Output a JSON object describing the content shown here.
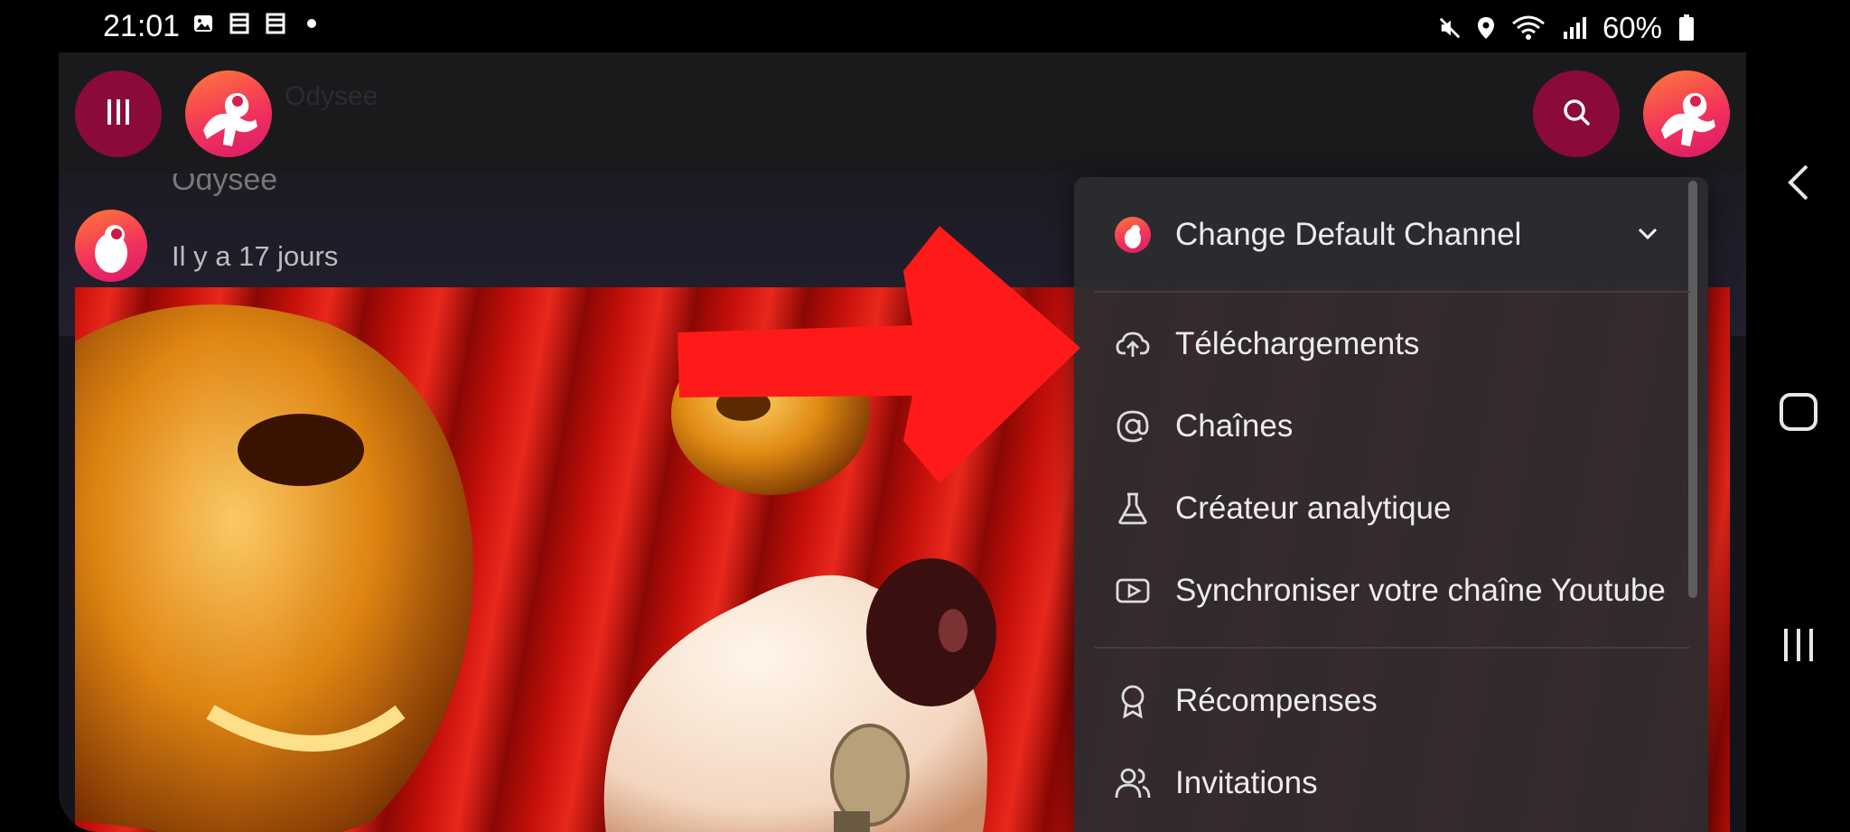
{
  "status_bar": {
    "time": "21:01",
    "left_icons": [
      "gallery-icon",
      "calendar-icon",
      "calendar-icon",
      "dot-icon"
    ],
    "right_icons": [
      "mute-icon",
      "location-icon",
      "wifi-icon",
      "signal-icon"
    ],
    "battery_text": "60%"
  },
  "header": {
    "menu_icon": "menu-icon",
    "search_icon": "search-icon",
    "faded_title": "Odysee"
  },
  "post": {
    "author": "Odysee",
    "date": "Il y a 17 jours"
  },
  "menu": {
    "channel_label": "Change Default Channel",
    "items": [
      {
        "label": "Téléchargements",
        "icon": "upload-cloud-icon"
      },
      {
        "label": "Chaînes",
        "icon": "at-sign-icon"
      },
      {
        "label": "Créateur analytique",
        "icon": "flask-icon"
      },
      {
        "label": "Synchroniser votre chaîne Youtube",
        "icon": "youtube-icon"
      }
    ],
    "items2": [
      {
        "label": "Récompenses",
        "icon": "award-icon"
      },
      {
        "label": "Invitations",
        "icon": "users-icon"
      }
    ]
  },
  "colors": {
    "accent": "#8b0a3c",
    "arrow": "#ff1a1a",
    "menu_bg": "#2c2b2e"
  }
}
